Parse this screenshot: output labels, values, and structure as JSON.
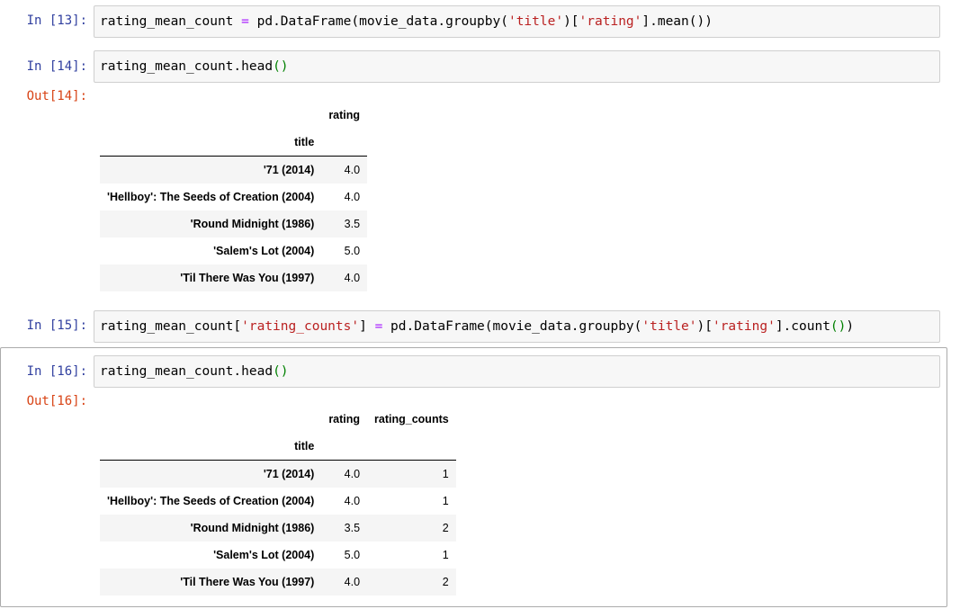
{
  "cells": [
    {
      "prompt": "In [13]:",
      "code": [
        {
          "t": "rating_mean_count ",
          "k": "plain"
        },
        {
          "t": "=",
          "k": "op"
        },
        {
          "t": " pd.DataFrame(movie_data.groupby(",
          "k": "plain"
        },
        {
          "t": "'title'",
          "k": "str"
        },
        {
          "t": ")[",
          "k": "plain"
        },
        {
          "t": "'rating'",
          "k": "str"
        },
        {
          "t": "].mean())",
          "k": "plain"
        }
      ]
    },
    {
      "prompt": "In [14]:",
      "code": [
        {
          "t": "rating_mean_count.head",
          "k": "plain"
        },
        {
          "t": "()",
          "k": "paren"
        }
      ],
      "out_prompt": "Out[14]:",
      "table": {
        "columns": [
          "rating"
        ],
        "index_name": "title",
        "rows": [
          {
            "title": "'71 (2014)",
            "values": [
              "4.0"
            ]
          },
          {
            "title": "'Hellboy': The Seeds of Creation (2004)",
            "values": [
              "4.0"
            ]
          },
          {
            "title": "'Round Midnight (1986)",
            "values": [
              "3.5"
            ]
          },
          {
            "title": "'Salem's Lot (2004)",
            "values": [
              "5.0"
            ]
          },
          {
            "title": "'Til There Was You (1997)",
            "values": [
              "4.0"
            ]
          }
        ]
      }
    },
    {
      "prompt": "In [15]:",
      "code": [
        {
          "t": "rating_mean_count[",
          "k": "plain"
        },
        {
          "t": "'rating_counts'",
          "k": "str"
        },
        {
          "t": "] ",
          "k": "plain"
        },
        {
          "t": "=",
          "k": "op"
        },
        {
          "t": " pd.DataFrame(movie_data.groupby(",
          "k": "plain"
        },
        {
          "t": "'title'",
          "k": "str"
        },
        {
          "t": ")[",
          "k": "plain"
        },
        {
          "t": "'rating'",
          "k": "str"
        },
        {
          "t": "].count",
          "k": "plain"
        },
        {
          "t": "()",
          "k": "paren"
        },
        {
          "t": ")",
          "k": "plain"
        }
      ]
    },
    {
      "prompt": "In [16]:",
      "code": [
        {
          "t": "rating_mean_count.head",
          "k": "plain"
        },
        {
          "t": "()",
          "k": "paren"
        }
      ],
      "out_prompt": "Out[16]:",
      "table": {
        "columns": [
          "rating",
          "rating_counts"
        ],
        "index_name": "title",
        "rows": [
          {
            "title": "'71 (2014)",
            "values": [
              "4.0",
              "1"
            ]
          },
          {
            "title": "'Hellboy': The Seeds of Creation (2004)",
            "values": [
              "4.0",
              "1"
            ]
          },
          {
            "title": "'Round Midnight (1986)",
            "values": [
              "3.5",
              "2"
            ]
          },
          {
            "title": "'Salem's Lot (2004)",
            "values": [
              "5.0",
              "1"
            ]
          },
          {
            "title": "'Til There Was You (1997)",
            "values": [
              "4.0",
              "2"
            ]
          }
        ]
      }
    }
  ],
  "colors": {
    "in_prompt": "#303F9F",
    "out_prompt": "#D84315",
    "string": "#BA2121",
    "operator": "#AA22FF",
    "paren": "#008000"
  }
}
